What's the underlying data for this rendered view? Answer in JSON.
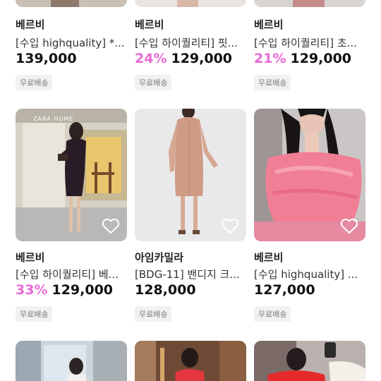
{
  "rows": [
    [
      {
        "seller": "베르비",
        "title": "[수입 highquality] *...",
        "discount": "",
        "price": "139,000",
        "badge": "무료배송"
      },
      {
        "seller": "베르비",
        "title": "[수입 하이퀄리티] 핏...",
        "discount": "24%",
        "price": "129,000",
        "badge": "무료배송"
      },
      {
        "seller": "베르비",
        "title": "[수입 하이퀄리티] 초...",
        "discount": "21%",
        "price": "129,000",
        "badge": "무료배송"
      }
    ],
    [
      {
        "seller": "베르비",
        "title": "[수입 하이퀄리티] 베...",
        "discount": "33%",
        "price": "129,000",
        "badge": "무료배송",
        "photo_text": "ZARA HOME"
      },
      {
        "seller": "아임카밀라",
        "title": "[BDG-11] 밴디지 크...",
        "discount": "",
        "price": "128,000",
        "badge": "무료배송"
      },
      {
        "seller": "베르비",
        "title": "[수입 highquality] ...",
        "discount": "",
        "price": "127,000",
        "badge": "무료배송"
      }
    ]
  ],
  "colors": {
    "discount": "#ea6ad6",
    "badge_bg": "#f1f1f1"
  },
  "icons": {
    "wishlist": "heart-outline-icon"
  }
}
